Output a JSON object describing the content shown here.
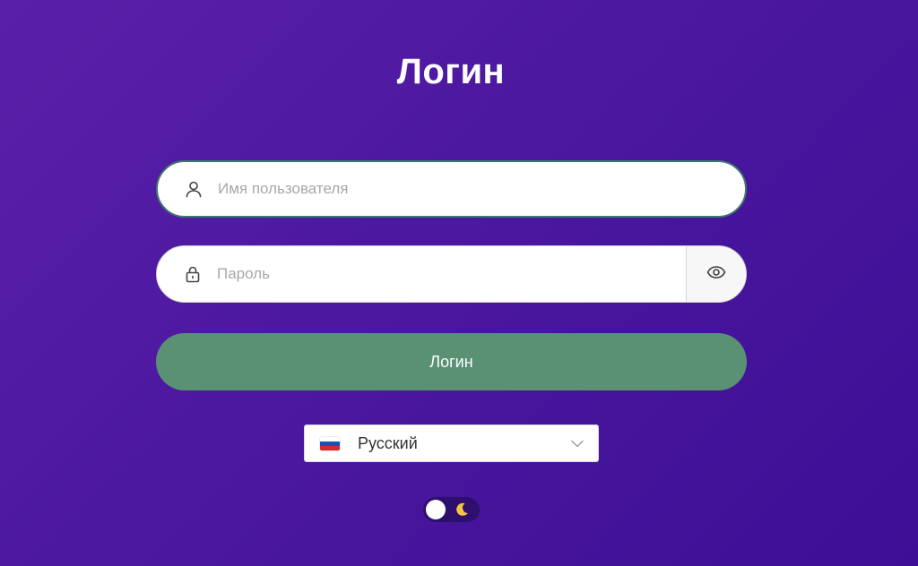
{
  "title": "Логин",
  "username": {
    "placeholder": "Имя пользователя",
    "value": "",
    "icon": "user-icon"
  },
  "password": {
    "placeholder": "Пароль",
    "value": "",
    "icon": "lock-icon",
    "toggle_icon": "eye-icon"
  },
  "login_button": {
    "label": "Логин"
  },
  "language": {
    "selected": "Русский",
    "flag": "russia-flag-icon"
  },
  "theme_toggle": {
    "icon": "moon-icon",
    "state": "light"
  },
  "colors": {
    "background_start": "#5a1fa8",
    "background_end": "#3d0f96",
    "login_button": "#5a9175",
    "username_border": "#3d7a6a"
  }
}
